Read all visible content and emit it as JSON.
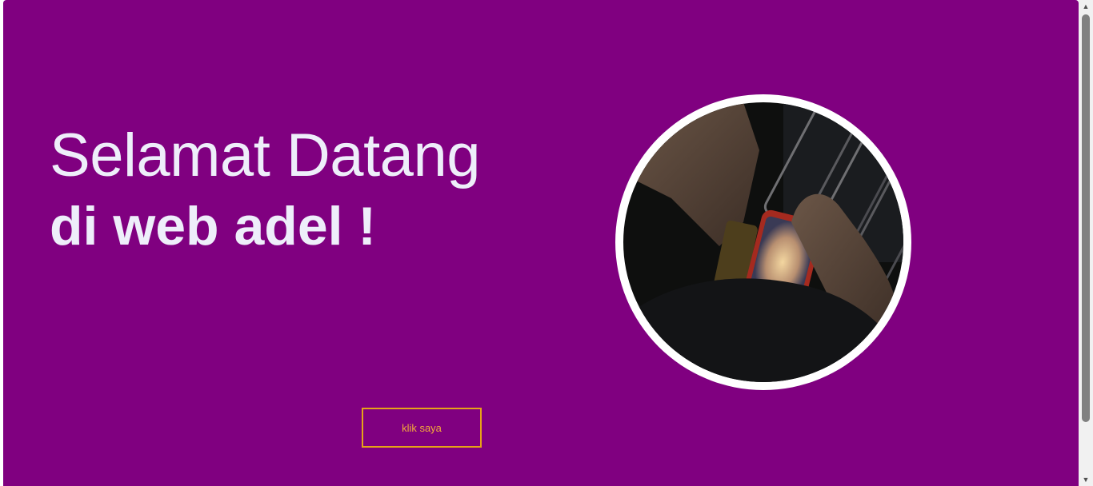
{
  "hero": {
    "title_line1": "Selamat Datang",
    "title_line2": "di web adel !",
    "button_label": "klik saya"
  },
  "colors": {
    "background": "#800080",
    "title": "#eeeefa",
    "button_border": "#e6a317",
    "button_text": "#f2a93b"
  },
  "icons": {
    "scroll_up": "▲",
    "scroll_down": "▼"
  }
}
